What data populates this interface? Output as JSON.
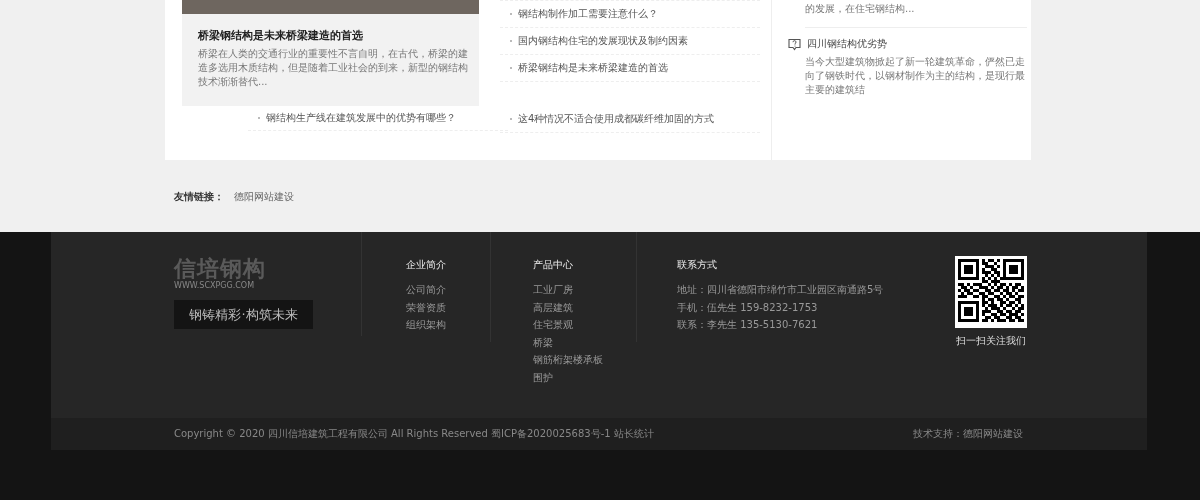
{
  "featured": {
    "title": "桥梁钢结构是未来桥梁建造的首选",
    "excerpt": "桥梁在人类的交通行业的重要性不言自明，在古代，桥梁的建造多选用木质结构，但是随着工业社会的到来，新型的钢结构技术渐渐替代..."
  },
  "left_list": [
    "钢结构生产线在建筑发展中的优势有哪些？"
  ],
  "news_list": [
    "钢结构制作加工需要注意什么？",
    "国内钢结构住宅的发展现状及制约因素",
    "桥梁钢结构是未来桥梁建造的首选",
    "这4种情况不适合使用成都碳纤维加固的方式"
  ],
  "sidebar": {
    "excerpt_tail": "的发展，在住宅钢结构...",
    "items": [
      {
        "title": "四川钢结构优劣势",
        "excerpt": "当今大型建筑物掀起了新一轮建筑革命，俨然已走向了钢铁时代，以钢材制作为主的结构，是现行最主要的建筑结"
      }
    ]
  },
  "friend_links": {
    "label": "友情链接：",
    "links": [
      "德阳网站建设"
    ]
  },
  "footer": {
    "logo": "信培钢构",
    "logo_url": "WWW.SCXPGG.COM",
    "slogan": "钢铸精彩·构筑未来",
    "columns": [
      {
        "title": "企业简介",
        "links": [
          "公司简介",
          "荣誉资质",
          "组织架构"
        ]
      },
      {
        "title": "产品中心",
        "links": [
          "工业厂房",
          "高层建筑",
          "住宅景观",
          "桥梁",
          "钢筋桁架楼承板",
          "围护"
        ]
      }
    ],
    "contact": {
      "title": "联系方式",
      "lines": [
        "地址：四川省德阳市绵竹市工业园区南通路5号",
        "手机：伍先生 159-8232-1753",
        "联系：李先生 135-5130-7621"
      ]
    },
    "qr_caption": "扫一扫关注我们"
  },
  "bottom_bar": {
    "copyright": "Copyright © 2020 四川信培建筑工程有限公司 All Rights Reserved 蜀ICP备2020025683号-1 站长统计",
    "support": "技术支持：德阳网站建设"
  }
}
